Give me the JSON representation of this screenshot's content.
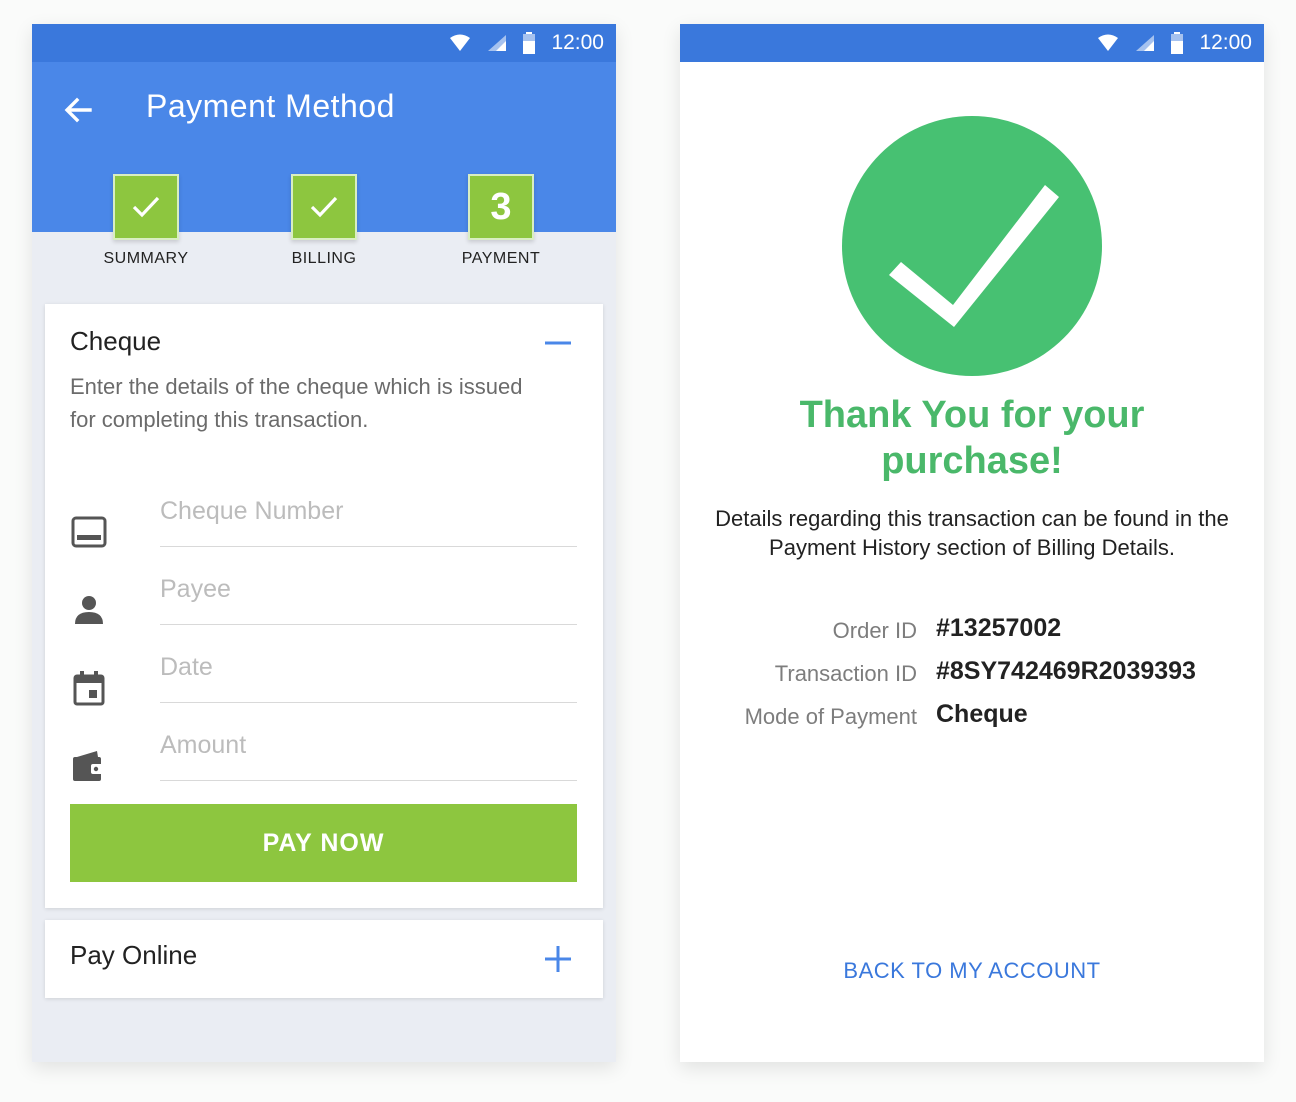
{
  "status_bar": {
    "time": "12:00"
  },
  "colors": {
    "primary": "#4a87e8",
    "primary_dark": "#3a78dc",
    "accent_green": "#8dc63f",
    "success_green": "#47c172"
  },
  "left_screen": {
    "title": "Payment Method",
    "steps": [
      {
        "label": "SUMMARY",
        "state": "done"
      },
      {
        "label": "BILLING",
        "state": "done"
      },
      {
        "label": "PAYMENT",
        "state": "current",
        "number": "3"
      }
    ],
    "cheque_section": {
      "title": "Cheque",
      "description": "Enter the details of the cheque which is issued for completing this transaction.",
      "fields": [
        {
          "placeholder": "Cheque Number",
          "icon": "card-icon"
        },
        {
          "placeholder": "Payee",
          "icon": "person-icon"
        },
        {
          "placeholder": "Date",
          "icon": "calendar-icon"
        },
        {
          "placeholder": "Amount",
          "icon": "wallet-icon"
        }
      ],
      "button": "PAY NOW"
    },
    "online_section": {
      "title": "Pay Online"
    }
  },
  "right_screen": {
    "heading": "Thank You for your purchase!",
    "details": "Details regarding this transaction can be found in the Payment History section of Billing Details.",
    "info": [
      {
        "label": "Order ID",
        "value": "#13257002"
      },
      {
        "label": "Transaction ID",
        "value": "#8SY742469R2039393"
      },
      {
        "label": "Mode of Payment",
        "value": "Cheque"
      }
    ],
    "back_link": "BACK TO MY ACCOUNT"
  }
}
